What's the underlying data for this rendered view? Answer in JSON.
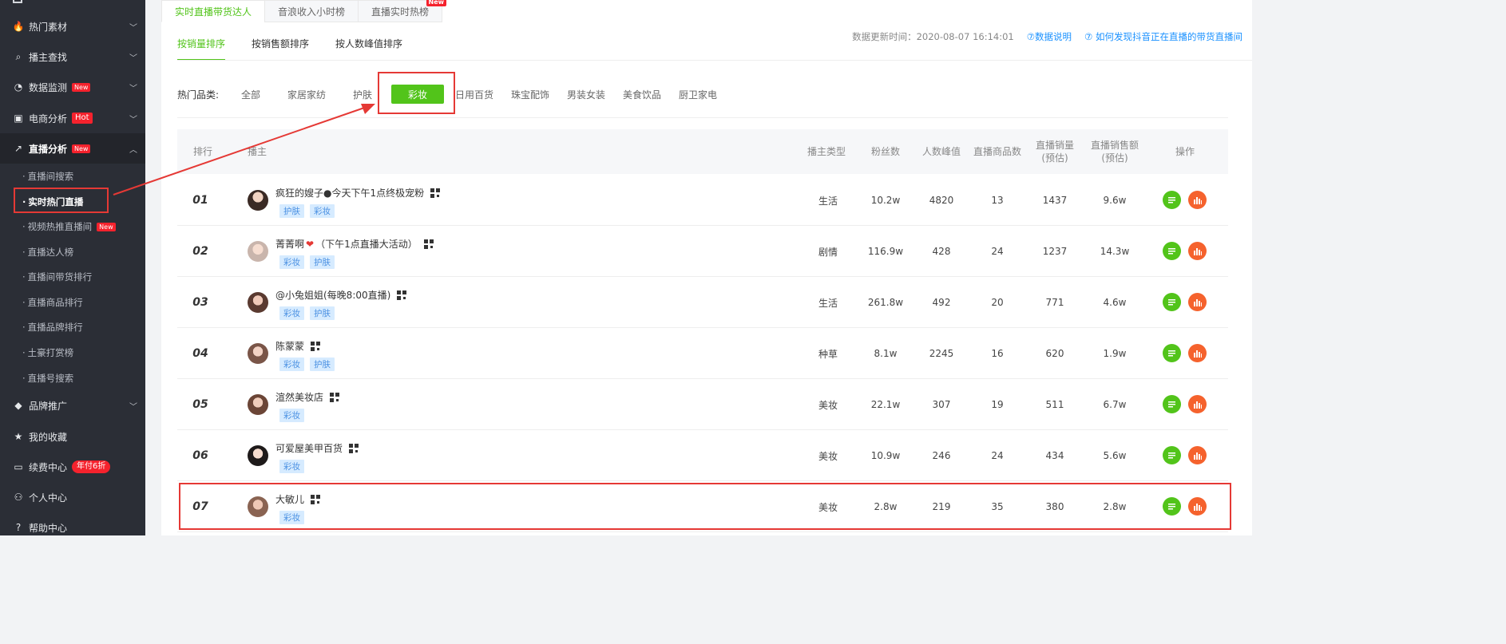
{
  "sidebar": {
    "menu": [
      {
        "label": "热门素材",
        "icon": "flame-icon",
        "badge": ""
      },
      {
        "label": "播主查找",
        "icon": "search-icon",
        "badge": ""
      },
      {
        "label": "数据监测",
        "icon": "monitor-icon",
        "badge": "New"
      },
      {
        "label": "电商分析",
        "icon": "bag-icon",
        "badge": "Hot"
      },
      {
        "label": "直播分析",
        "icon": "chart-line-icon",
        "badge": "New"
      }
    ],
    "sub": [
      "直播间搜索",
      "实时热门直播",
      "视频热推直播间",
      "直播达人榜",
      "直播间带货排行",
      "直播商品排行",
      "直播品牌排行",
      "土豪打赏榜",
      "直播号搜索"
    ],
    "sub_new_badge": "New",
    "menu_bottom": [
      {
        "label": "品牌推广",
        "icon": "diamond-icon",
        "badge": ""
      },
      {
        "label": "我的收藏",
        "icon": "star-icon",
        "badge": ""
      },
      {
        "label": "续费中心",
        "icon": "card-icon",
        "badge": "年付6折"
      },
      {
        "label": "个人中心",
        "icon": "user-icon",
        "badge": ""
      },
      {
        "label": "帮助中心",
        "icon": "help-icon",
        "badge": ""
      }
    ]
  },
  "top_tabs": [
    "实时直播带货达人",
    "音浪收入小时榜",
    "直播实时热榜"
  ],
  "top_tab_new": "New",
  "sort_tabs": [
    "按销量排序",
    "按销售额排序",
    "按人数峰值排序"
  ],
  "update": {
    "text": "数据更新时间：2020-08-07 16:14:01",
    "link1": "⑦数据说明",
    "link2": "⑦ 如何发现抖音正在直播的带货直播间"
  },
  "categories": {
    "label": "热门品类:",
    "items": [
      "全部",
      "家居家纺",
      "护肤",
      "彩妆",
      "日用百货",
      "珠宝配饰",
      "男装女装",
      "美食饮品",
      "厨卫家电"
    ],
    "selected": "彩妆"
  },
  "table": {
    "headers": {
      "rank": "排行",
      "anchor": "播主",
      "type": "播主类型",
      "fans": "粉丝数",
      "peak": "人数峰值",
      "goods": "直播商品数",
      "sales_1": "直播销量",
      "sales_2": "(预估)",
      "amount_1": "直播销售额",
      "amount_2": "(预估)",
      "op": "操作"
    },
    "rows": [
      {
        "rank": "01",
        "name": "疯狂的嫂子●今天下午1点终极宠粉",
        "tags": [
          "护肤",
          "彩妆"
        ],
        "type": "生活",
        "fans": "10.2w",
        "peak": "4820",
        "goods": "13",
        "sales": "1437",
        "amount": "9.6w"
      },
      {
        "rank": "02",
        "name": "菁菁啊",
        "name_suffix": "（下午1点直播大活动）",
        "tags": [
          "彩妆",
          "护肤"
        ],
        "type": "剧情",
        "fans": "116.9w",
        "peak": "428",
        "goods": "24",
        "sales": "1237",
        "amount": "14.3w"
      },
      {
        "rank": "03",
        "name": "@小兔姐姐(每晚8:00直播)",
        "tags": [
          "彩妆",
          "护肤"
        ],
        "type": "生活",
        "fans": "261.8w",
        "peak": "492",
        "goods": "20",
        "sales": "771",
        "amount": "4.6w"
      },
      {
        "rank": "04",
        "name": "陈蒙蒙",
        "tags": [
          "彩妆",
          "护肤"
        ],
        "type": "种草",
        "fans": "8.1w",
        "peak": "2245",
        "goods": "16",
        "sales": "620",
        "amount": "1.9w"
      },
      {
        "rank": "05",
        "name": "渲然美妆店",
        "tags": [
          "彩妆"
        ],
        "type": "美妆",
        "fans": "22.1w",
        "peak": "307",
        "goods": "19",
        "sales": "511",
        "amount": "6.7w"
      },
      {
        "rank": "06",
        "name": "可爱屋美甲百货",
        "tags": [
          "彩妆"
        ],
        "type": "美妆",
        "fans": "10.9w",
        "peak": "246",
        "goods": "24",
        "sales": "434",
        "amount": "5.6w"
      },
      {
        "rank": "07",
        "name": "大敏儿",
        "tags": [
          "彩妆"
        ],
        "type": "美妆",
        "fans": "2.8w",
        "peak": "219",
        "goods": "35",
        "sales": "380",
        "amount": "2.8w"
      }
    ]
  },
  "colors": {
    "accent": "#52c41a",
    "highlight": "#e53935",
    "sidebar_bg": "#2b2e36"
  }
}
